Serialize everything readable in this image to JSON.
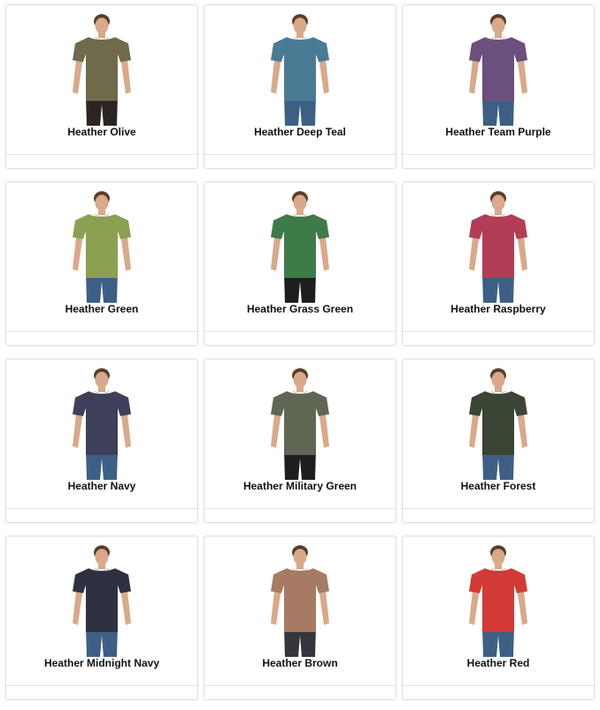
{
  "products": [
    {
      "label": "Heather Olive",
      "shirt": "#6f6a4c",
      "pants": "#2a2520"
    },
    {
      "label": "Heather Deep Teal",
      "shirt": "#4a7b95",
      "pants": "#3d5f86"
    },
    {
      "label": "Heather Team Purple",
      "shirt": "#6b4f7c",
      "pants": "#3d5f86"
    },
    {
      "label": "Heather Green",
      "shirt": "#8aa052",
      "pants": "#3d5f86"
    },
    {
      "label": "Heather Grass Green",
      "shirt": "#3f7a49",
      "pants": "#1e1e1e"
    },
    {
      "label": "Heather Raspberry",
      "shirt": "#b23d57",
      "pants": "#3d5f86"
    },
    {
      "label": "Heather Navy",
      "shirt": "#3d4058",
      "pants": "#3d5f86"
    },
    {
      "label": "Heather Military Green",
      "shirt": "#5f6653",
      "pants": "#1e1e1e"
    },
    {
      "label": "Heather Forest",
      "shirt": "#3a4535",
      "pants": "#3d5f86"
    },
    {
      "label": "Heather Midnight Navy",
      "shirt": "#2f3140",
      "pants": "#3d5f86"
    },
    {
      "label": "Heather Brown",
      "shirt": "#a67a63",
      "pants": "#34363c"
    },
    {
      "label": "Heather Red",
      "shirt": "#d33a35",
      "pants": "#3d5f86"
    }
  ]
}
